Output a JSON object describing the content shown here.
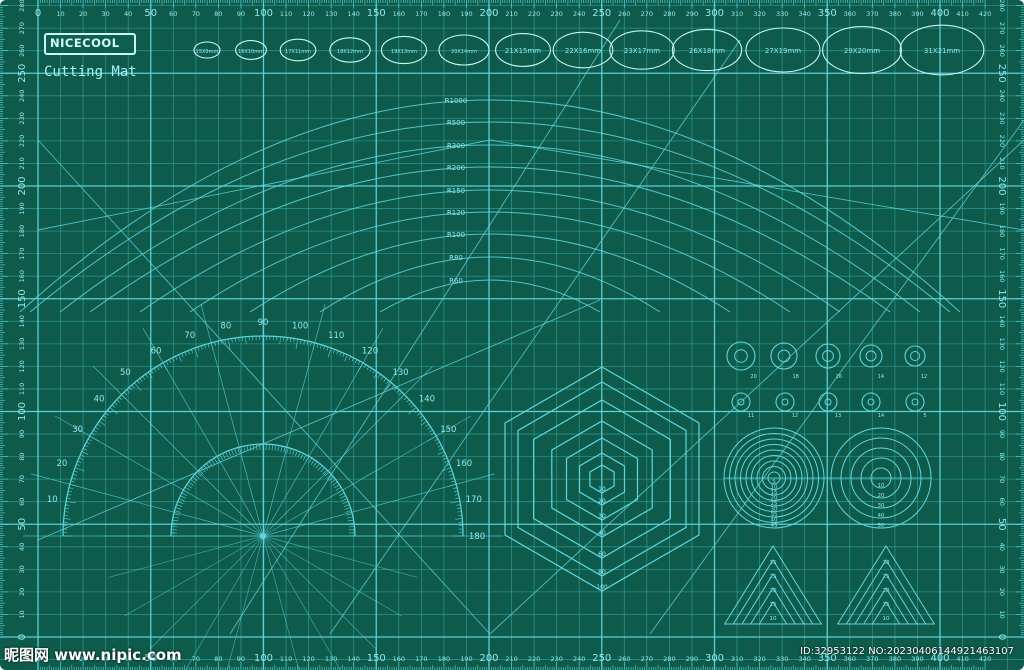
{
  "brand": {
    "name": "NICECOOL",
    "subtitle": "Cutting Mat"
  },
  "colors": {
    "mat": "#0e5b4b",
    "grid_minor": "#2f9e98",
    "grid_major": "#5fd6de",
    "text": "#8fe8ef"
  },
  "scale": {
    "top_labels": [
      "0",
      "10",
      "20",
      "30",
      "40",
      "50",
      "60",
      "70",
      "80",
      "90",
      "100",
      "110",
      "120",
      "130",
      "140",
      "150",
      "160",
      "170",
      "180",
      "190",
      "200",
      "210",
      "220",
      "230",
      "240",
      "250",
      "260",
      "270",
      "280",
      "290",
      "300",
      "310",
      "320",
      "330",
      "340",
      "350",
      "360",
      "370",
      "380",
      "390",
      "400",
      "410",
      "420"
    ],
    "side_labels": [
      "0",
      "10",
      "20",
      "30",
      "40",
      "50",
      "60",
      "70",
      "80",
      "90",
      "100",
      "110",
      "120",
      "130",
      "140",
      "150",
      "160",
      "170",
      "180",
      "190",
      "200",
      "210",
      "220",
      "230",
      "240",
      "250",
      "260",
      "270",
      "280"
    ]
  },
  "ovals": [
    "15X9mm",
    "16X10mm",
    "17X11mm",
    "18X12mm",
    "19X13mm",
    "20X14mm",
    "21X15mm",
    "22X16mm",
    "23X17mm",
    "26X18mm",
    "27X19mm",
    "29X20mm",
    "31X21mm"
  ],
  "arcs": [
    "R1000",
    "R500",
    "R300",
    "R200",
    "R150",
    "R120",
    "R100",
    "R80",
    "R60"
  ],
  "protractor_outer": [
    "180",
    "170",
    "160",
    "150",
    "140",
    "130",
    "120",
    "110",
    "100",
    "90",
    "80",
    "70",
    "60",
    "50",
    "40",
    "30",
    "20",
    "10"
  ],
  "hexagon_labels": [
    "10",
    "20",
    "30",
    "40",
    "60",
    "80",
    "100"
  ],
  "small_circles": [
    "20",
    "18",
    "16",
    "14",
    "12",
    "11",
    "12",
    "13",
    "14",
    "5"
  ],
  "large_circle_left": [
    "5",
    "10",
    "15",
    "20",
    "25",
    "30",
    "35",
    "40",
    "45"
  ],
  "large_circle_right": [
    "10",
    "20",
    "30",
    "40",
    "50"
  ],
  "triangle_left": [
    "35",
    "25",
    "20",
    "15",
    "10"
  ],
  "triangle_right": [
    "30",
    "25",
    "20",
    "15",
    "10"
  ],
  "watermark": {
    "left": "昵图网 www.nipic.com",
    "right": "ID:32953122 NO:20230406144921463107"
  }
}
